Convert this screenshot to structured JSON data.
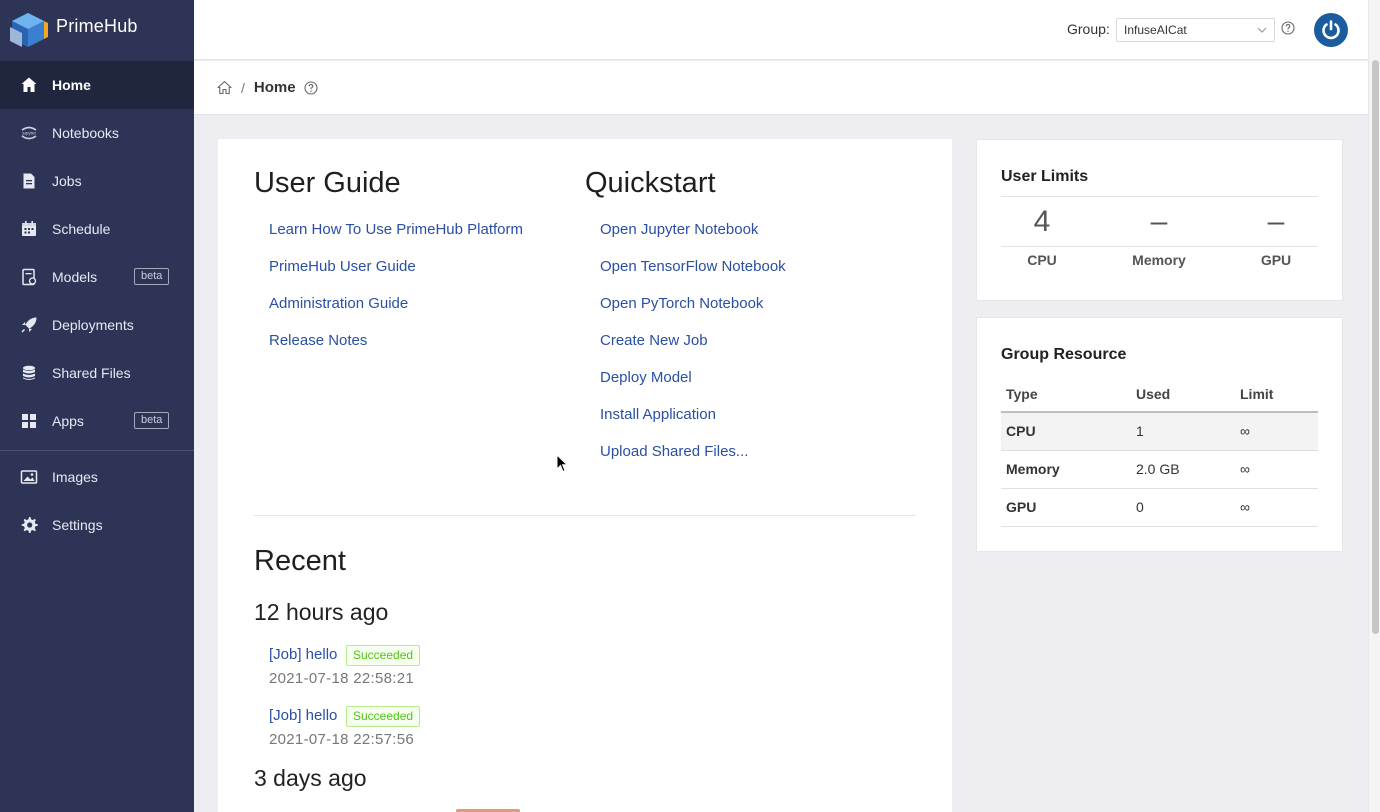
{
  "brand": {
    "name": "PrimeHub"
  },
  "sidebar": {
    "items": [
      {
        "label": "Home",
        "icon": "home-icon"
      },
      {
        "label": "Notebooks",
        "icon": "jupyter-icon"
      },
      {
        "label": "Jobs",
        "icon": "document-icon"
      },
      {
        "label": "Schedule",
        "icon": "calendar-icon"
      },
      {
        "label": "Models",
        "icon": "model-icon",
        "badge": "beta"
      },
      {
        "label": "Deployments",
        "icon": "rocket-icon"
      },
      {
        "label": "Shared Files",
        "icon": "database-icon"
      },
      {
        "label": "Apps",
        "icon": "apps-icon",
        "badge": "beta"
      },
      {
        "label": "Images",
        "icon": "image-icon"
      },
      {
        "label": "Settings",
        "icon": "gear-icon"
      }
    ]
  },
  "header": {
    "group_label": "Group:",
    "group_value": "InfuseAICat"
  },
  "breadcrumb": {
    "current": "Home",
    "separator": "/"
  },
  "user_guide": {
    "title": "User Guide",
    "links": [
      "Learn How To Use PrimeHub Platform",
      "PrimeHub User Guide",
      "Administration Guide",
      "Release Notes"
    ]
  },
  "quickstart": {
    "title": "Quickstart",
    "links": [
      "Open Jupyter Notebook",
      "Open TensorFlow Notebook",
      "Open PyTorch Notebook",
      "Create New Job",
      "Deploy Model",
      "Install Application",
      "Upload Shared Files..."
    ]
  },
  "recent": {
    "title": "Recent",
    "groups": [
      {
        "when": "12 hours ago",
        "items": [
          {
            "name": "[Job] hello",
            "status": "Succeeded",
            "time": "2021-07-18 22:58:21"
          },
          {
            "name": "[Job] hello",
            "status": "Succeeded",
            "time": "2021-07-18 22:57:56"
          }
        ]
      },
      {
        "when": "3 days ago",
        "items": []
      }
    ]
  },
  "user_limits": {
    "title": "User Limits",
    "cpu": {
      "value": "4",
      "label": "CPU"
    },
    "memory": {
      "value": "–",
      "label": "Memory"
    },
    "gpu": {
      "value": "–",
      "label": "GPU"
    }
  },
  "group_resource": {
    "title": "Group Resource",
    "headers": [
      "Type",
      "Used",
      "Limit"
    ],
    "rows": [
      [
        "CPU",
        "1",
        "∞"
      ],
      [
        "Memory",
        "2.0 GB",
        "∞"
      ],
      [
        "GPU",
        "0",
        "∞"
      ]
    ]
  },
  "colors": {
    "sidebar": "#2d3456",
    "link": "#2a4fa3",
    "success": "#52c41a",
    "avatar": "#1a5c9e"
  }
}
